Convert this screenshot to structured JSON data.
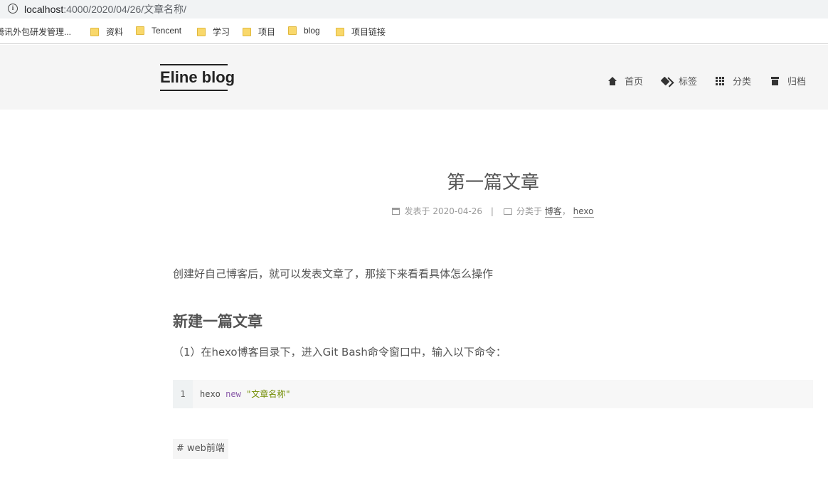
{
  "browser": {
    "url_host": "localhost",
    "url_path": ":4000/2020/04/26/文章名称/",
    "info_icon": "info-icon",
    "bookmarks": [
      {
        "label": "腾讯外包研发管理...",
        "icon": "folder-icon"
      },
      {
        "label": "资料",
        "icon": "folder-icon"
      },
      {
        "label": "Tencent",
        "icon": "folder-icon"
      },
      {
        "label": "学习",
        "icon": "folder-icon"
      },
      {
        "label": "项目",
        "icon": "folder-icon"
      },
      {
        "label": "blog",
        "icon": "folder-icon"
      },
      {
        "label": "项目链接",
        "icon": "folder-icon"
      }
    ]
  },
  "site": {
    "brand": "Eline blog",
    "nav": [
      {
        "label": "首页",
        "icon": "home-icon"
      },
      {
        "label": "标签",
        "icon": "tags-icon"
      },
      {
        "label": "分类",
        "icon": "th-icon"
      },
      {
        "label": "归档",
        "icon": "archive-icon"
      }
    ]
  },
  "post": {
    "title": "第一篇文章",
    "meta": {
      "posted_label": "发表于",
      "date": "2020-04-26",
      "separator": "|",
      "category_label": "分类于",
      "categories": [
        "博客",
        "hexo"
      ],
      "comma": "，"
    },
    "intro": "创建好自己博客后，就可以发表文章了，那接下来看看具体怎么操作",
    "heading": "新建一篇文章",
    "step1": "（1）在hexo博客目录下，进入Git Bash命令窗口中，输入以下命令：",
    "code": {
      "line_number": "1",
      "cmd": "hexo",
      "keyword": "new",
      "string": "\"文章名称\""
    },
    "tag": "# web前端"
  }
}
